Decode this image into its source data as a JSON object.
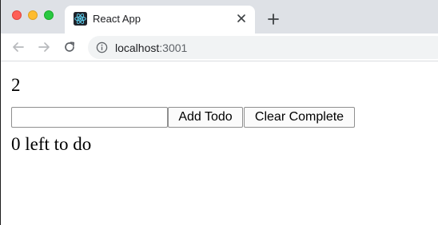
{
  "browser": {
    "tab": {
      "title": "React App",
      "favicon": "react-atom-icon"
    },
    "new_tab_icon": "plus-icon",
    "address": {
      "host": "localhost",
      "port": ":3001",
      "security_icon": "info-icon"
    },
    "nav": {
      "back": "arrow-left-icon",
      "forward": "arrow-right-icon",
      "reload": "reload-icon"
    }
  },
  "app": {
    "count": "2",
    "input": {
      "value": "",
      "placeholder": ""
    },
    "add_button": "Add Todo",
    "clear_button": "Clear Complete",
    "left_to_do": "0 left to do"
  },
  "colors": {
    "tabstrip": "#dee1e6",
    "omnibox": "#f1f3f4",
    "react_blue": "#61dafb"
  }
}
